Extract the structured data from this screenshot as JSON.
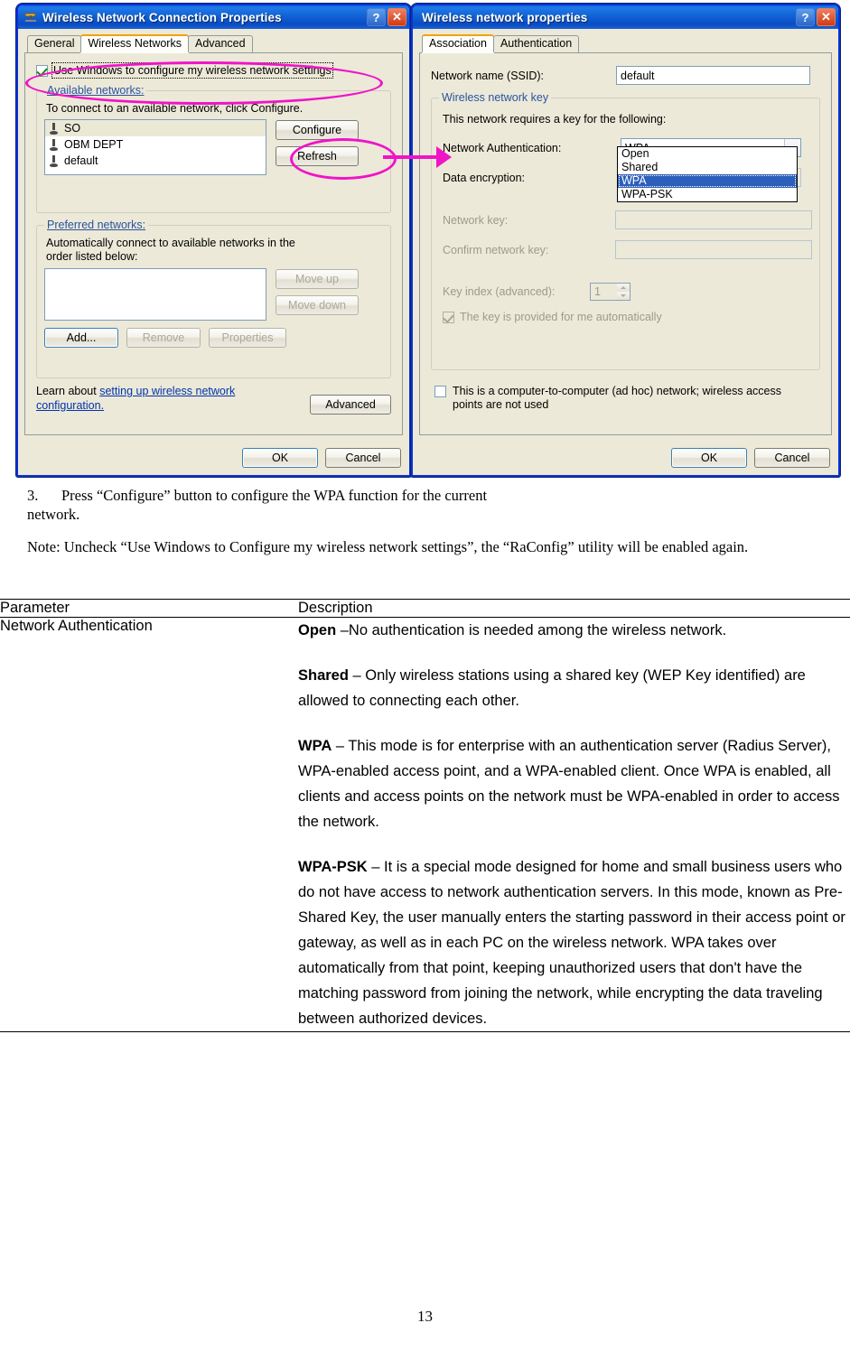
{
  "left_dialog": {
    "title": "Wireless Network Connection Properties",
    "titlebar_icon": "network-adapter-icon",
    "help_button": "?",
    "close_button": "✕",
    "tabs": [
      {
        "label": "General",
        "active": false
      },
      {
        "label": "Wireless Networks",
        "active": true
      },
      {
        "label": "Advanced",
        "active": false
      }
    ],
    "use_windows_checkbox": {
      "label": "Use Windows to configure my wireless network settings",
      "checked": true
    },
    "available_group": {
      "legend": "Available networks:",
      "instruction": "To connect to an available network, click Configure.",
      "networks": [
        {
          "name": "SO",
          "selected": true
        },
        {
          "name": "OBM DEPT",
          "selected": false
        },
        {
          "name": "default",
          "selected": false
        }
      ],
      "configure_button": "Configure",
      "refresh_button": "Refresh"
    },
    "preferred_group": {
      "legend": "Preferred networks:",
      "instruction": "Automatically connect to available networks in the order listed below:",
      "networks": [],
      "move_up_button": "Move up",
      "move_down_button": "Move down",
      "add_button": "Add...",
      "remove_button": "Remove",
      "properties_button": "Properties"
    },
    "learn_prefix": "Learn about ",
    "learn_link": "setting up wireless network configuration.",
    "advanced_button": "Advanced",
    "ok_button": "OK",
    "cancel_button": "Cancel"
  },
  "right_dialog": {
    "title": "Wireless network properties",
    "help_button": "?",
    "close_button": "✕",
    "tabs": [
      {
        "label": "Association",
        "active": true
      },
      {
        "label": "Authentication",
        "active": false
      }
    ],
    "ssid_label": "Network name (SSID):",
    "ssid_value": "default",
    "key_group": {
      "legend": "Wireless network key",
      "requires_text": "This network requires a key for the following:",
      "auth_label": "Network Authentication:",
      "auth_value": "WPA",
      "auth_options": [
        "Open",
        "Shared",
        "WPA",
        "WPA-PSK"
      ],
      "auth_selected_index": 2,
      "encryption_label": "Data encryption:",
      "encryption_value": "",
      "network_key_label": "Network key:",
      "network_key_value": "",
      "confirm_key_label": "Confirm network key:",
      "confirm_key_value": "",
      "key_index_label": "Key index (advanced):",
      "key_index_value": "1",
      "auto_key_checkbox": {
        "label": "The key is provided for me automatically",
        "checked": true
      }
    },
    "adhoc_checkbox": {
      "label": "This is a computer-to-computer (ad hoc) network; wireless access points are not used",
      "checked": false
    },
    "ok_button": "OK",
    "cancel_button": "Cancel"
  },
  "annotation": {
    "color": "#f014c8",
    "shapes": [
      "ellipse-checkbox",
      "ellipse-configure-button",
      "arrow-to-right-dialog"
    ]
  },
  "document": {
    "step": {
      "number": "3.",
      "text": "Press “Configure” button to configure the WPA function for the current network."
    },
    "note": "Note: Uncheck “Use Windows to Configure my wireless network settings”, the “RaConfig” utility will be enabled again.",
    "table": {
      "headers": [
        "Parameter",
        "Description"
      ],
      "rows": [
        {
          "parameter": "Network Authentication",
          "description_paragraphs": [
            {
              "term": "Open",
              "text": " –No authentication is needed among the wireless network."
            },
            {
              "term": "Shared",
              "text": " – Only wireless stations using a shared key (WEP Key identified) are allowed to connecting each other."
            },
            {
              "term": "WPA",
              "text": " – This mode is for enterprise with an authentication server (Radius Server), WPA-enabled access point, and a WPA-enabled client. Once WPA is enabled, all clients and access points on the network must be WPA-enabled in order to access the network."
            },
            {
              "term": "WPA-PSK",
              "text": " – It is a special mode designed for home and small business users who do not have access to network authentication servers. In this mode, known as Pre-Shared Key, the user manually enters the starting password in their access point or gateway, as well as in each PC on the wireless network. WPA takes over automatically from that point, keeping unauthorized users that don't have the matching password from joining the network, while encrypting the data traveling between authorized devices."
            }
          ]
        }
      ]
    },
    "page_number": "13"
  }
}
